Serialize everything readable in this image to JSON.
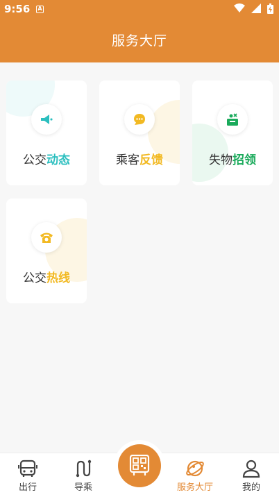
{
  "status": {
    "time": "9:56",
    "notif_badge": "A"
  },
  "header": {
    "title": "服务大厅"
  },
  "colors": {
    "accent": "#e38a35",
    "teal": "#2bbfbf",
    "yellow": "#f2b922",
    "green": "#1aaa5b"
  },
  "cards": [
    {
      "prefix": "公交",
      "highlight": "动态",
      "icon": "megaphone-icon"
    },
    {
      "prefix": "乘客",
      "highlight": "反馈",
      "icon": "chat-icon"
    },
    {
      "prefix": "失物",
      "highlight": "招领",
      "icon": "lost-box-icon"
    },
    {
      "prefix": "公交",
      "highlight": "热线",
      "icon": "telephone-icon"
    }
  ],
  "tabs": [
    {
      "label": "出行",
      "icon": "bus-icon"
    },
    {
      "label": "导乘",
      "icon": "route-icon"
    },
    {
      "label": "",
      "icon": "qr-bus-icon"
    },
    {
      "label": "服务大厅",
      "icon": "planet-icon"
    },
    {
      "label": "我的",
      "icon": "user-icon"
    }
  ]
}
